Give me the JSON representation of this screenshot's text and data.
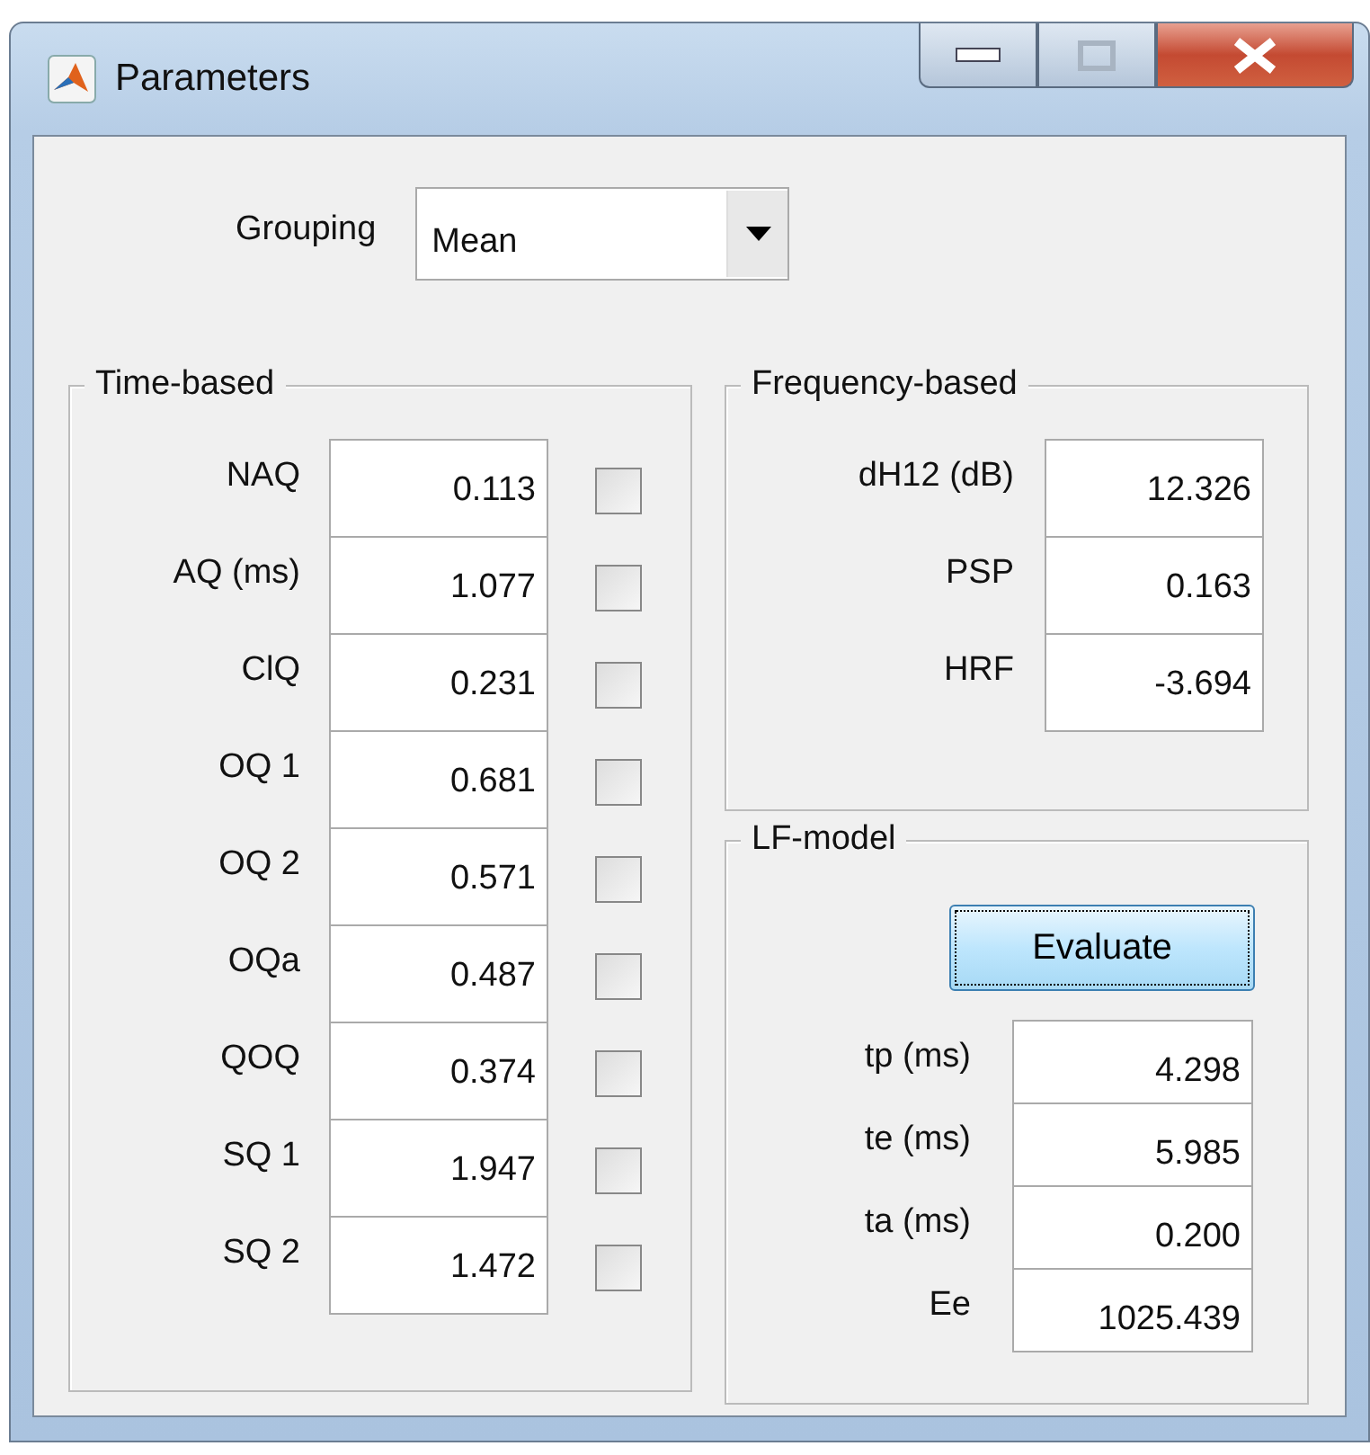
{
  "window": {
    "title": "Parameters"
  },
  "grouping": {
    "label": "Grouping",
    "value": "Mean"
  },
  "time_based": {
    "title": "Time-based",
    "rows": [
      {
        "label": "NAQ",
        "value": "0.113",
        "checked": false
      },
      {
        "label": "AQ (ms)",
        "value": "1.077",
        "checked": false
      },
      {
        "label": "ClQ",
        "value": "0.231",
        "checked": false
      },
      {
        "label": "OQ 1",
        "value": "0.681",
        "checked": false
      },
      {
        "label": "OQ 2",
        "value": "0.571",
        "checked": false
      },
      {
        "label": "OQa",
        "value": "0.487",
        "checked": false
      },
      {
        "label": "QOQ",
        "value": "0.374",
        "checked": false
      },
      {
        "label": "SQ 1",
        "value": "1.947",
        "checked": false
      },
      {
        "label": "SQ 2",
        "value": "1.472",
        "checked": false
      }
    ]
  },
  "frequency_based": {
    "title": "Frequency-based",
    "rows": [
      {
        "label": "dH12 (dB)",
        "value": "12.326"
      },
      {
        "label": "PSP",
        "value": "0.163"
      },
      {
        "label": "HRF",
        "value": "-3.694"
      }
    ]
  },
  "lf_model": {
    "title": "LF-model",
    "button": "Evaluate",
    "rows": [
      {
        "label": "tp (ms)",
        "value": "4.298"
      },
      {
        "label": "te (ms)",
        "value": "5.985"
      },
      {
        "label": "ta (ms)",
        "value": "0.200"
      },
      {
        "label": "Ee",
        "value": "1025.439"
      }
    ]
  }
}
